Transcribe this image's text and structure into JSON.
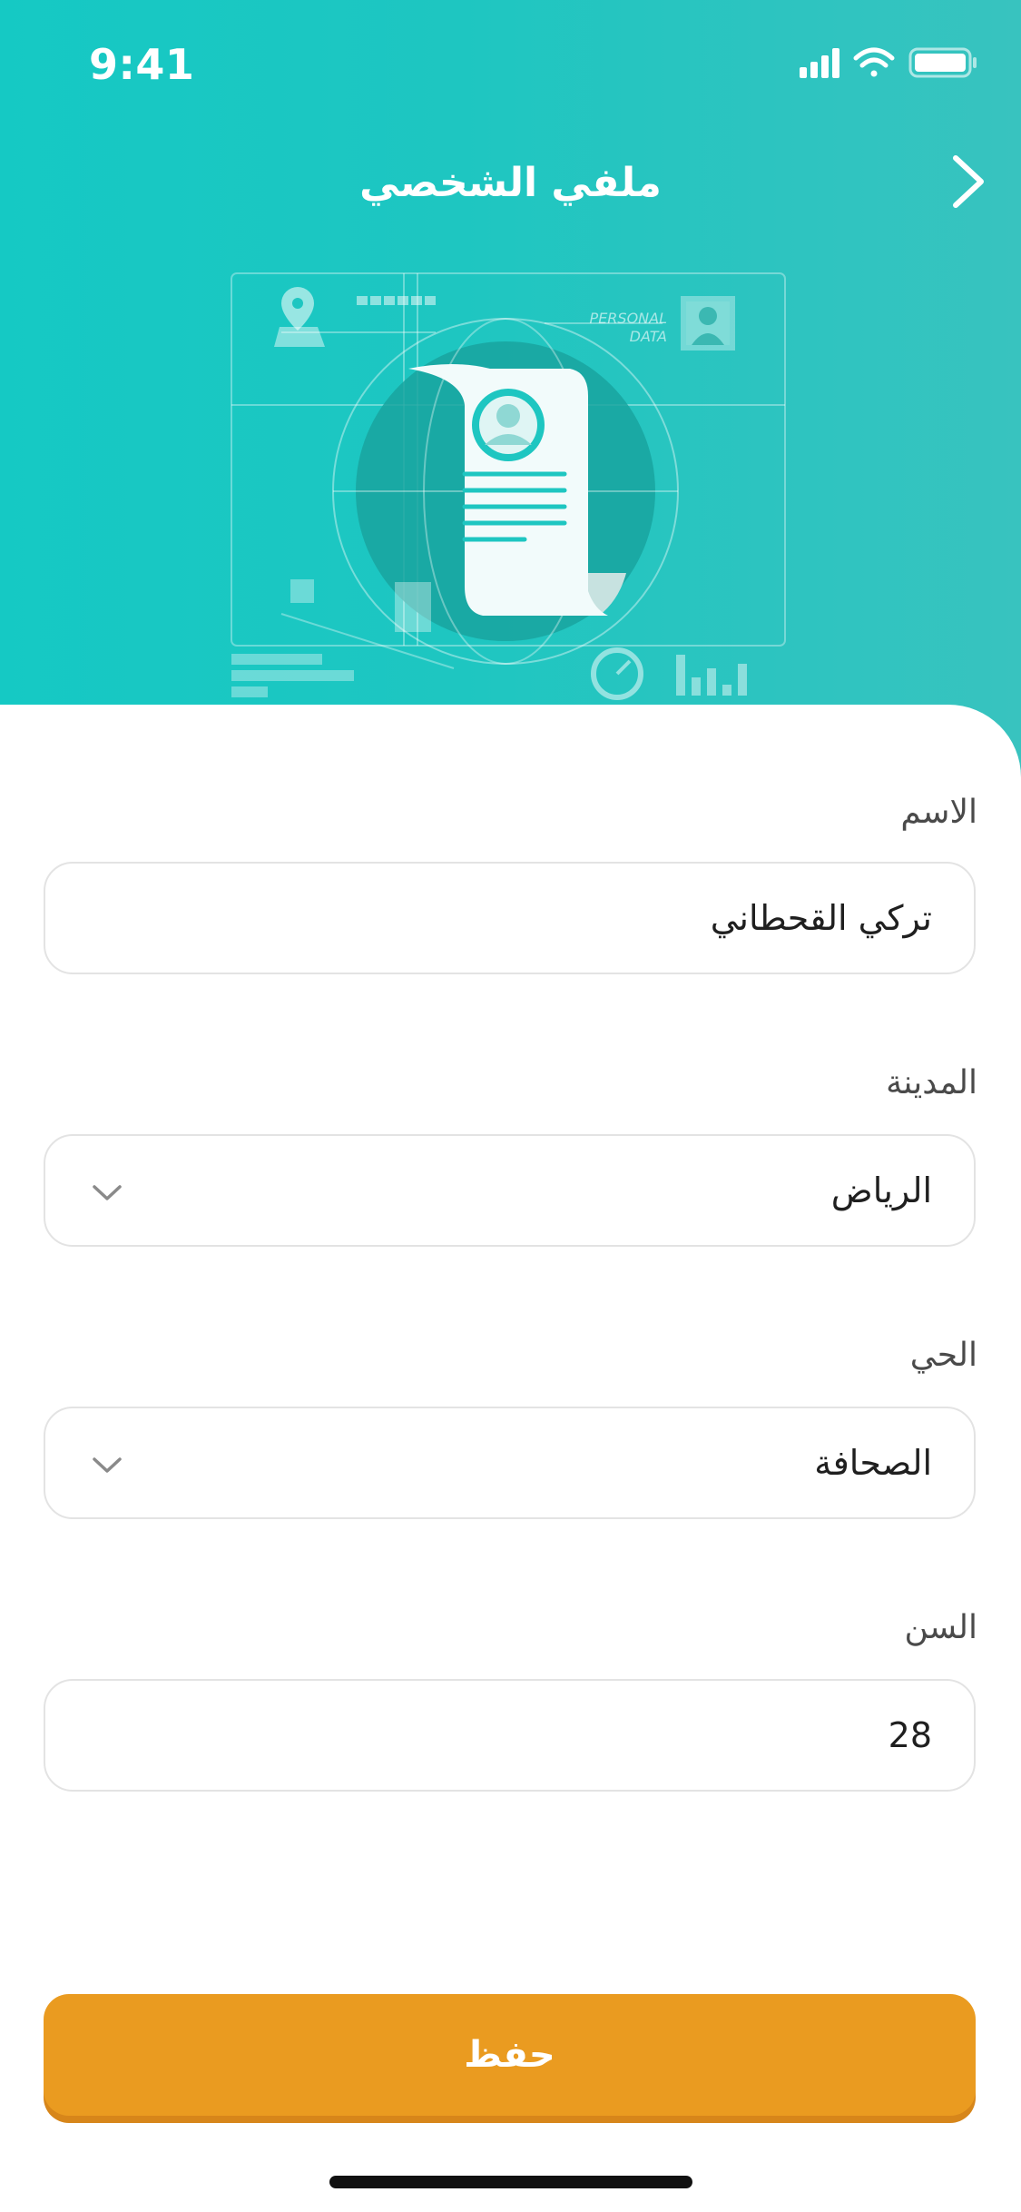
{
  "status_bar": {
    "time": "9:41"
  },
  "header": {
    "title": "ملفي الشخصي",
    "illustration_label_line1": "PERSONAL",
    "illustration_label_line2": "DATA"
  },
  "form": {
    "name": {
      "label": "الاسم",
      "value": "تركي القحطاني"
    },
    "city": {
      "label": "المدينة",
      "value": "الرياض"
    },
    "district": {
      "label": "الحي",
      "value": "الصحافة"
    },
    "age": {
      "label": "السن",
      "value": "28"
    }
  },
  "save_button": {
    "label": "حفظ"
  },
  "colors": {
    "header_gradient_start": "#15c9c4",
    "header_gradient_end": "#38c3bf",
    "accent_button": "#ea9b20"
  },
  "icons": [
    "signal-icon",
    "wifi-icon",
    "battery-icon",
    "back-chevron-icon",
    "dropdown-chevron-icon"
  ]
}
